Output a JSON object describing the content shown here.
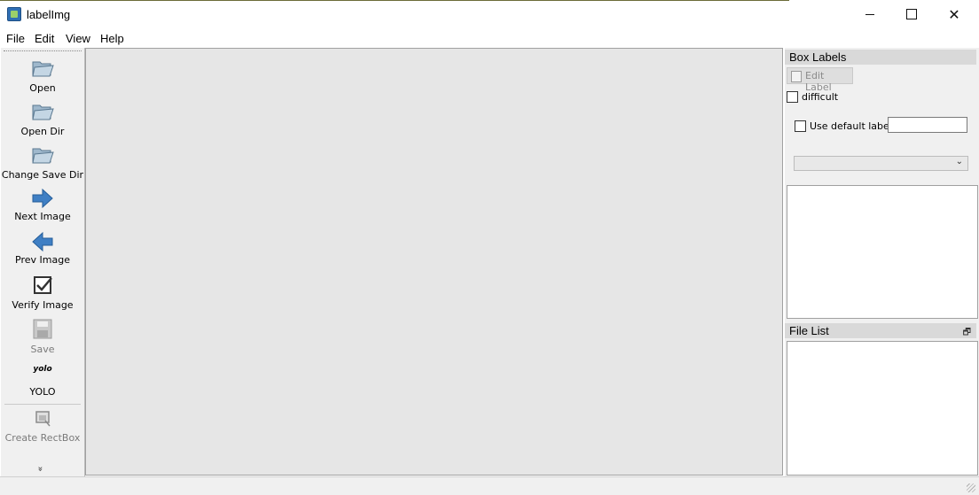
{
  "window": {
    "title": "labelImg"
  },
  "menu": {
    "items": [
      "File",
      "Edit",
      "View",
      "Help"
    ]
  },
  "toolbar": {
    "open": "Open",
    "open_dir": "Open Dir",
    "change_save_dir": "Change Save Dir",
    "next_image": "Next Image",
    "prev_image": "Prev Image",
    "verify_image": "Verify Image",
    "save": "Save",
    "format_icon_text": "yolo",
    "format": "YOLO",
    "create_rectbox": "Create RectBox",
    "more": "»"
  },
  "box_labels": {
    "title": "Box Labels",
    "edit_label": "Edit Label",
    "difficult": "difficult",
    "use_default_label": "Use default label",
    "default_label_value": ""
  },
  "file_list": {
    "title": "File List"
  },
  "colors": {
    "canvas": "#e6e6e6",
    "panel": "#f0f0f0",
    "dock_title": "#d9d9d9"
  }
}
